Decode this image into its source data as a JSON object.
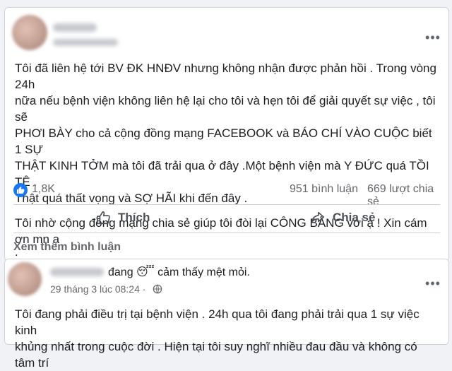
{
  "post1": {
    "author_name": "",
    "body_line1": "Tôi đã liên hệ tới BV ĐK HNĐV nhưng không nhận được phản hồi . Trong vòng 24h",
    "body_line2": "nữa nếu bệnh viện không liên hệ lại cho tôi và hẹn tôi để giải quyết sự việc , tôi sẽ",
    "body_line3": "PHƠI BÀY cho cả cộng đồng mạng FACEBOOK và BÁO CHÍ VÀO CUỘC  biết 1 SỰ",
    "body_line4": "THẬT KINH TỞM mà tôi đã trải qua ở đây .Một bệnh viện mà Y ĐỨC quá TỒI TỆ .",
    "body_line5": "Thật quá thất vọng và SỢ HÃI khi đến đây .",
    "body_line6": "Tôi nhờ cộng đồng mạng chia sẻ giúp tôi đòi lại CÔNG BẰNG với ạ ! Xin cám ơn mn ạ",
    "body_line7": ".",
    "reaction_count": "1,8K",
    "comment_count": "951 bình luận",
    "share_count": "669 lượt chia sẻ",
    "like_label": "Thích",
    "share_label": "Chia sẻ",
    "see_more_comments": "Xem thêm bình luận"
  },
  "post2": {
    "status_text": "đang 😴 cảm thấy mệt mỏi.",
    "timestamp": "29 tháng 3 lúc 08:24 · ",
    "body_line1": "Tôi đang phải điều trị tại bệnh viện . 24h qua tôi đang phải trải qua 1 sự việc kinh",
    "body_line2": "khủng nhất trong cuộc đời . Hiện tại tôi suy nghĩ nhiều đau đầu và không có tâm trí"
  },
  "icons": {
    "more": "more-horizontal-icon",
    "like_reaction": "thumbs-up-icon",
    "like_action": "like-outline-icon",
    "share_action": "share-icon",
    "privacy": "globe-icon"
  },
  "colors": {
    "facebook_blue": "#1877f2",
    "text": "#1c1e21",
    "muted": "#65676b"
  }
}
